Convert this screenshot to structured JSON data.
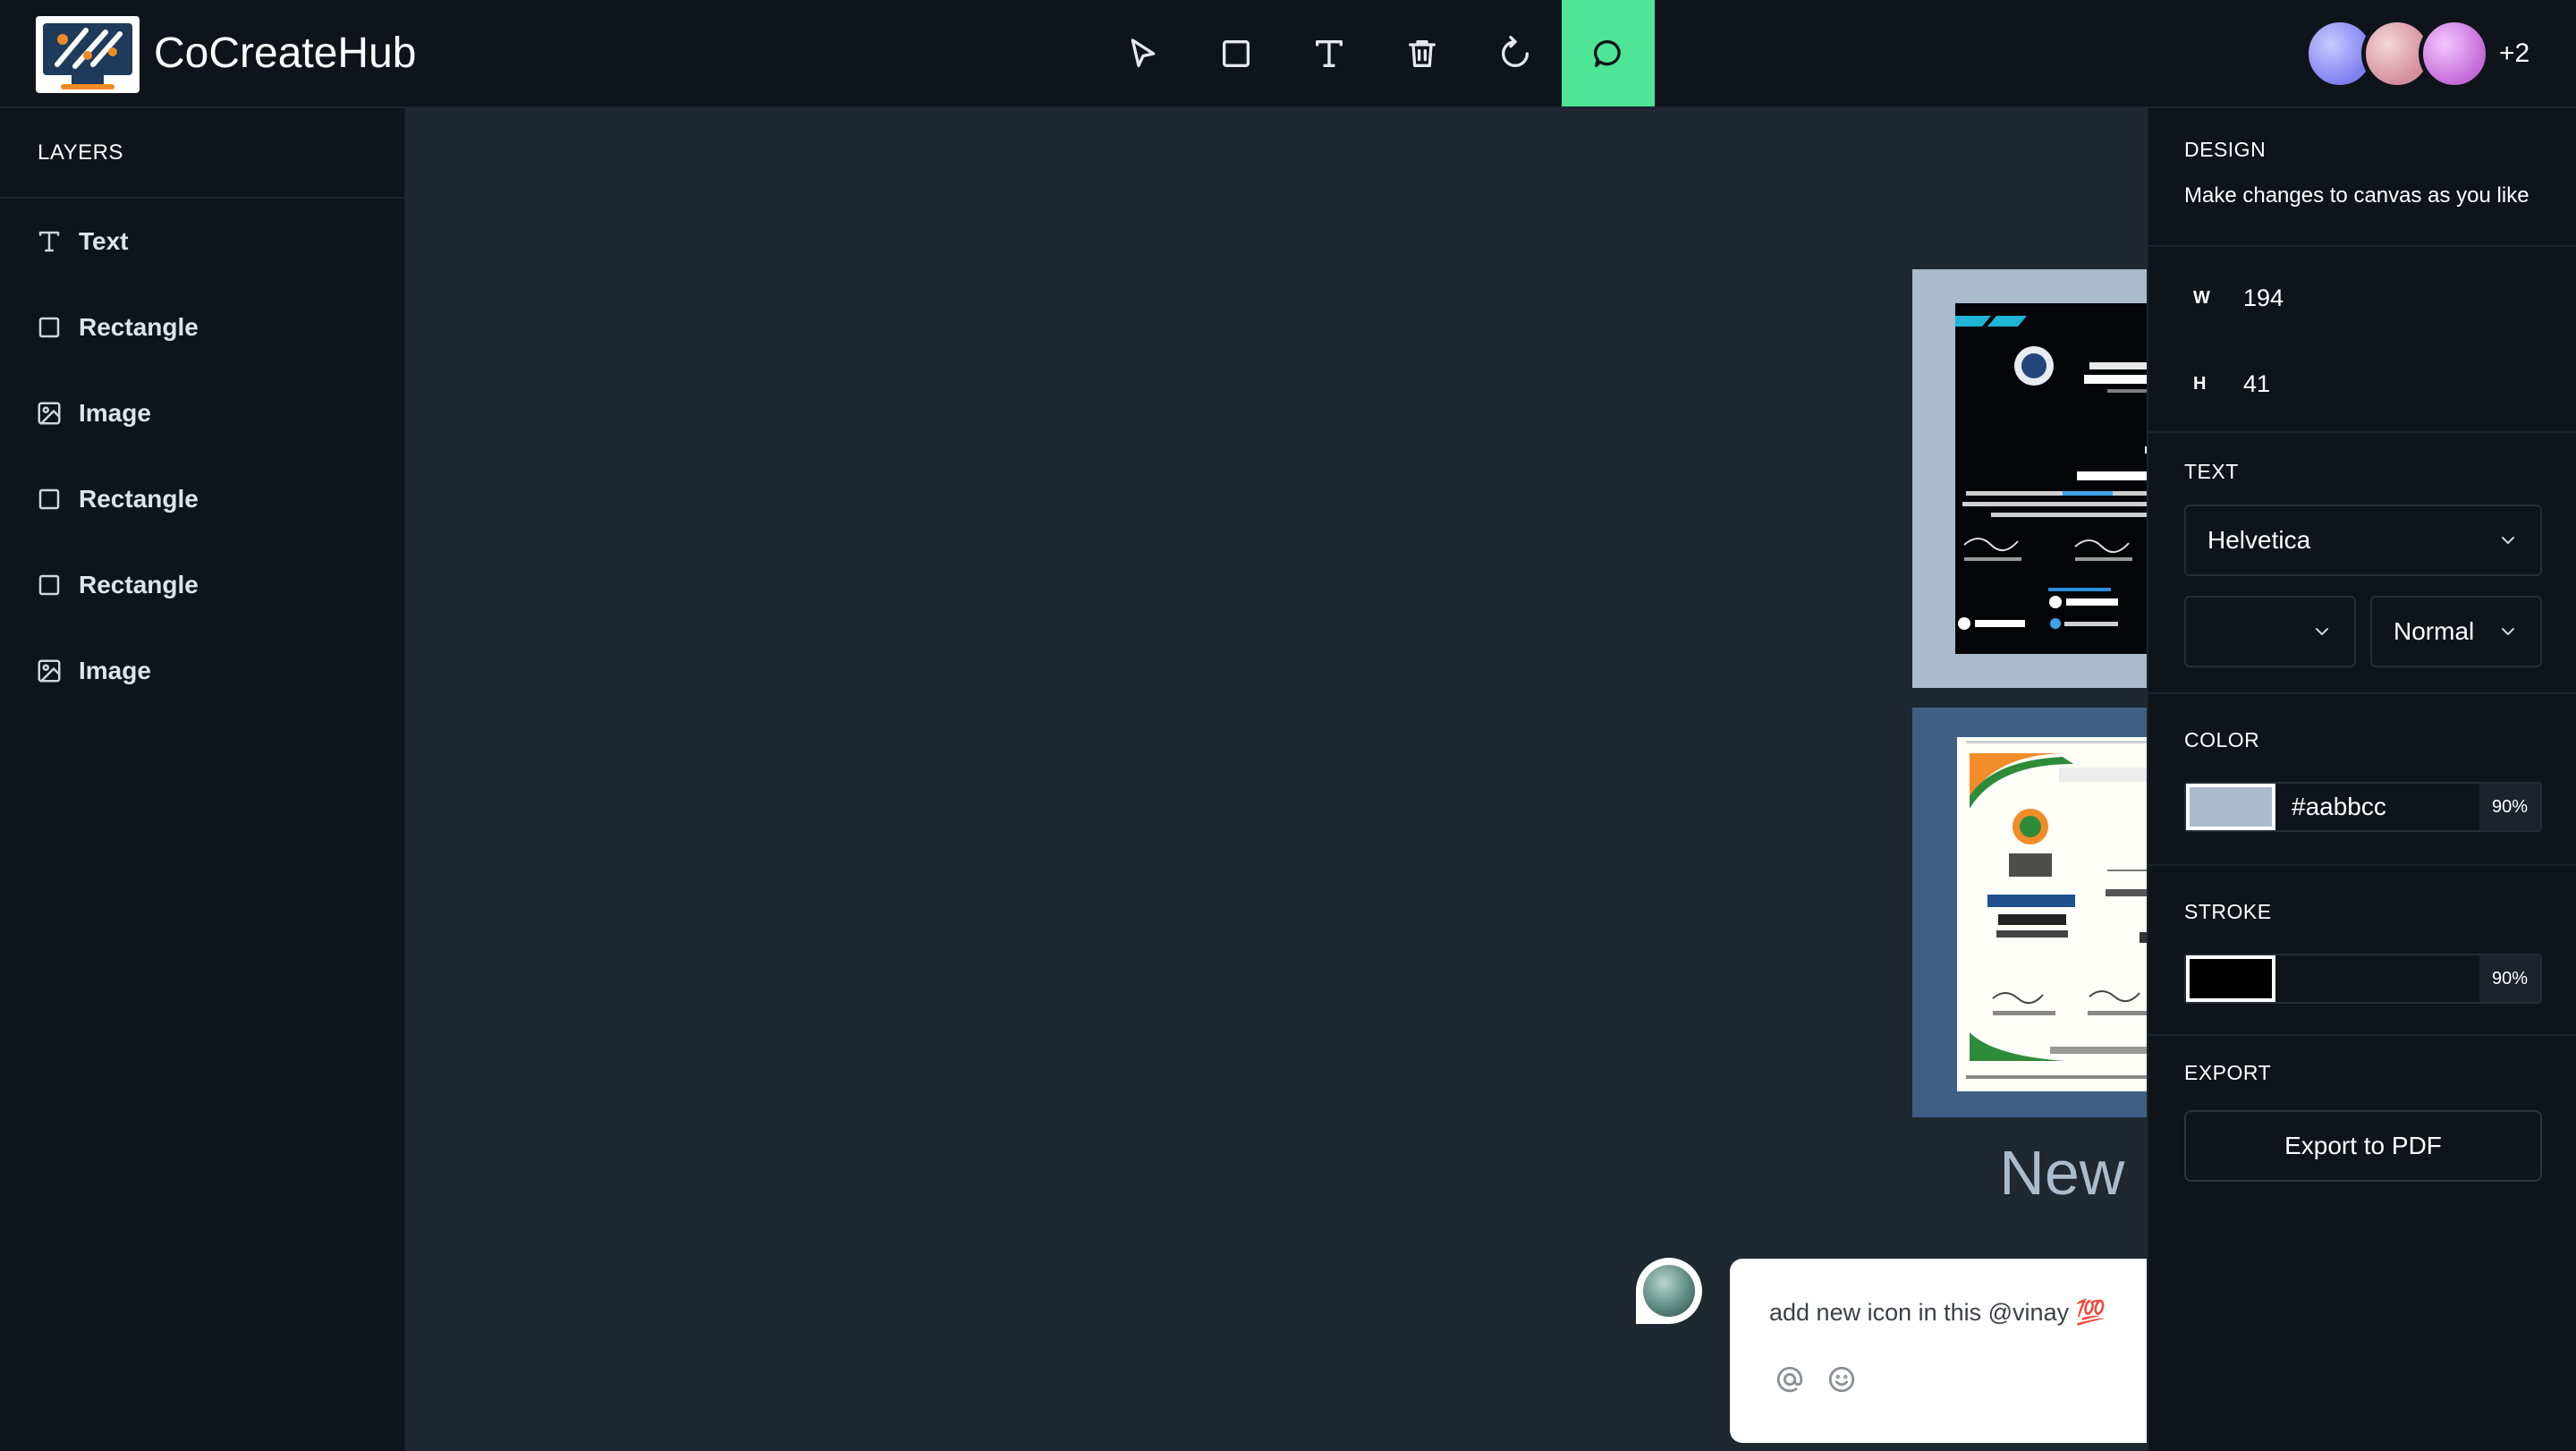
{
  "app": {
    "name": "CoCreateHub"
  },
  "toolbar": {
    "tools": [
      "select",
      "rectangle",
      "text",
      "delete",
      "reset",
      "comments"
    ],
    "active_tool": "comments",
    "active_color": "#4ee596"
  },
  "collaborators": {
    "extra_count": "+2"
  },
  "layers": {
    "title": "LAYERS",
    "items": [
      {
        "label": "Text",
        "icon": "text-icon"
      },
      {
        "label": "Rectangle",
        "icon": "rectangle-icon"
      },
      {
        "label": "Image",
        "icon": "image-icon"
      },
      {
        "label": "Rectangle",
        "icon": "rectangle-icon"
      },
      {
        "label": "Rectangle",
        "icon": "rectangle-icon"
      },
      {
        "label": "Image",
        "icon": "image-icon"
      }
    ]
  },
  "canvas": {
    "design_title": "New Design",
    "frame1_color": "#aabbcc",
    "frame2_color": "#3f5f84",
    "comment": {
      "text": "add new icon in this @vinay 💯"
    }
  },
  "design_panel": {
    "title": "DESIGN",
    "subtitle": "Make changes to canvas as you like",
    "width_label": "W",
    "width_value": "194",
    "height_label": "H",
    "height_value": "41",
    "text_title": "TEXT",
    "font_family": "Helvetica",
    "font_size": "",
    "font_weight": "Normal",
    "color_title": "COLOR",
    "fill_hex": "#aabbcc",
    "fill_opacity": "90%",
    "stroke_title": "STROKE",
    "stroke_hex": "#000000",
    "stroke_opacity": "90%",
    "export_title": "EXPORT",
    "export_label": "Export to PDF"
  }
}
